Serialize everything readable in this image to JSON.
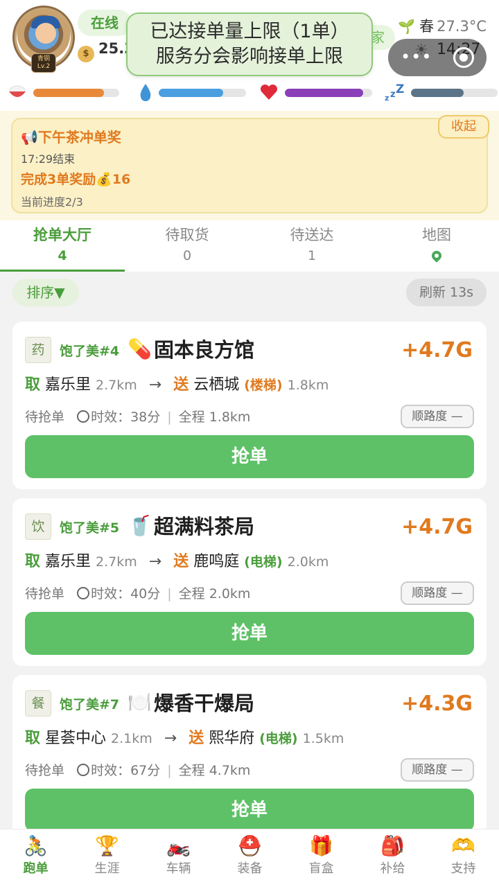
{
  "header": {
    "avatar_badge": "青铜\nLv.2",
    "status": "在线",
    "home": "回家",
    "money": "25.3",
    "weather": {
      "season": "春",
      "temp": "27.3°C"
    },
    "clock": "14:27",
    "toast": {
      "line1": "已达接单量上限（1单）",
      "line2": "服务分会影响接单上限"
    },
    "stats": [
      {
        "name": "hunger",
        "level": 0.82,
        "color": "#e8893a"
      },
      {
        "name": "thirst",
        "level": 0.74,
        "color": "#4a9fe0"
      },
      {
        "name": "health",
        "level": 0.9,
        "color": "#8a3fb8"
      },
      {
        "name": "energy",
        "level": 0.61,
        "color": "#5b7488"
      }
    ]
  },
  "promo": {
    "title": "下午茶冲单奖",
    "ends": "17:29结束",
    "reward": "完成3单奖励💰16",
    "progress": "当前进度2/3",
    "collapse": "收起"
  },
  "tabs": [
    {
      "label": "抢单大厅",
      "count": "4"
    },
    {
      "label": "待取货",
      "count": "0"
    },
    {
      "label": "待送达",
      "count": "1"
    },
    {
      "label": "地图",
      "count": ""
    }
  ],
  "toolbar": {
    "sort": "排序▼",
    "refresh": "刷新 13s"
  },
  "orders": [
    {
      "category": "药",
      "brand": "饱了美#4",
      "emoji": "💊",
      "shop": "固本良方馆",
      "reward": "+4.7G",
      "pickup_label": "取",
      "pickup": "嘉乐里",
      "pickup_dist": "2.7km",
      "drop_label": "送",
      "drop": "云栖城",
      "drop_tag": "(楼梯)",
      "drop_dist": "1.8km",
      "status": "待抢单",
      "timer": "时效：38分",
      "total": "全程 1.8km",
      "match": "顺路度 —",
      "button": "抢单"
    },
    {
      "category": "饮",
      "brand": "饱了美#5",
      "emoji": "🥤",
      "shop": "超满料茶局",
      "reward": "+4.7G",
      "pickup_label": "取",
      "pickup": "嘉乐里",
      "pickup_dist": "2.7km",
      "drop_label": "送",
      "drop": "鹿鸣庭",
      "drop_tag": "(电梯)",
      "drop_dist": "2.0km",
      "status": "待抢单",
      "timer": "时效：40分",
      "total": "全程 2.0km",
      "match": "顺路度 —",
      "button": "抢单"
    },
    {
      "category": "餐",
      "brand": "饱了美#7",
      "emoji": "🍽️",
      "shop": "爆香干爆局",
      "reward": "+4.3G",
      "pickup_label": "取",
      "pickup": "星荟中心",
      "pickup_dist": "2.1km",
      "drop_label": "送",
      "drop": "熙华府",
      "drop_tag": "(电梯)",
      "drop_dist": "1.5km",
      "status": "待抢单",
      "timer": "时效：67分",
      "total": "全程 4.7km",
      "match": "顺路度 —",
      "button": "抢单"
    }
  ],
  "nav": [
    {
      "label": "跑单",
      "icon": "🚴"
    },
    {
      "label": "生涯",
      "icon": "🏆"
    },
    {
      "label": "车辆",
      "icon": "🏍️"
    },
    {
      "label": "装备",
      "icon": "⛑️"
    },
    {
      "label": "盲盒",
      "icon": "🎁"
    },
    {
      "label": "补给",
      "icon": "🎒"
    },
    {
      "label": "支持",
      "icon": "🫶"
    }
  ]
}
